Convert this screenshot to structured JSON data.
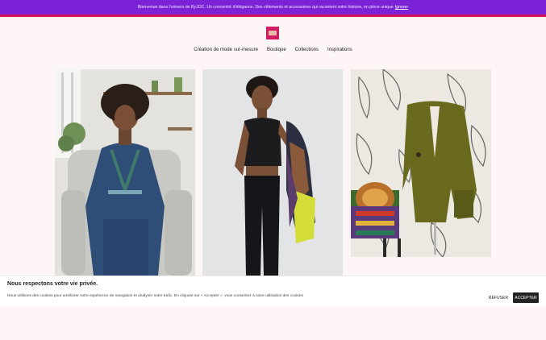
{
  "announcement": {
    "text": "Bienvenue dans l'univers de ByJOC. Un concentré d'élégance. Des vêtements et accessoires qui racontent votre histoire, en pièce unique",
    "link_label": "Ignorer"
  },
  "colors": {
    "announcement_bg": "#7b22d6",
    "accent": "#d2145a",
    "page_bg": "#fdf5f6"
  },
  "nav": {
    "items": [
      {
        "label": "Création de mode sur-mesure"
      },
      {
        "label": "Boutique"
      },
      {
        "label": "Collections"
      },
      {
        "label": "Inspirations"
      }
    ]
  },
  "gallery": {
    "photos": [
      {
        "icon": "photo-woman-seated-blue-kimono"
      },
      {
        "icon": "photo-woman-black-outfit-jacket"
      },
      {
        "icon": "photo-olive-cardigan-mannequin"
      }
    ]
  },
  "cookie": {
    "title": "Nous respectons votre vie privée.",
    "text": "Nous utilisons des cookies pour améliorer votre expérience de navigation et analyser notre trafic. En cliquant sur « Accepter », vous consentez à notre utilisation des cookies",
    "refuse_label": "REFUSER",
    "accept_label": "ACCEPTER"
  }
}
